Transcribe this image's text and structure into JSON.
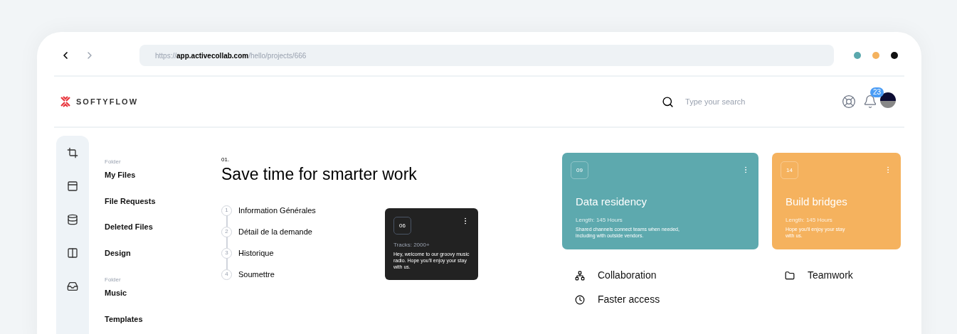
{
  "browser": {
    "url": "https://**app.activecollab.com**/hello/projects/666",
    "dots": [
      {
        "color": "#5aa8ad"
      },
      {
        "color": "#f4b25e"
      },
      {
        "color": "#111111"
      }
    ]
  },
  "header": {
    "logo": "SOFTYFLOW",
    "search": {
      "placeholder": "Type your search"
    },
    "notifications": "23"
  },
  "sidebar": {
    "groups": [
      {
        "label": "Folder",
        "items": [
          "My Files",
          "File Requests",
          "Deleted Files",
          "Design"
        ]
      },
      {
        "label": "Folder",
        "items": [
          "Music",
          "Templates"
        ]
      }
    ]
  },
  "intro": {
    "number": "01.",
    "title": "Save time for smarter work",
    "steps": [
      {
        "number": "1",
        "label": "Information Générales"
      },
      {
        "number": "2",
        "label": "Détail de la demande"
      },
      {
        "number": "3",
        "label": "Historique"
      },
      {
        "number": "4",
        "label": "Soumettre"
      }
    ]
  },
  "music_card": {
    "number": "06",
    "meta": "Tracks: 2000+",
    "text": "Hey, welcome to our groovy music radio. Hope you'll enjoy your stay with us."
  },
  "cards": [
    {
      "number": "09",
      "title": "Data residency",
      "meta": "Length: 145 Hours",
      "text": "Shared channels connect teams when needed, including with outside vendors.",
      "color": "#5da9ae"
    },
    {
      "number": "14",
      "title": "Build bridges",
      "meta": "Length: 145 Hours",
      "text": "Hope you'll enjoy your stay with us.",
      "color": "#f5b25e"
    }
  ],
  "features": [
    {
      "kind": "hierarchy",
      "label": "Collaboration"
    },
    {
      "kind": "folder",
      "label": "Teamwork"
    },
    {
      "kind": "clock",
      "label": "Faster access"
    }
  ]
}
